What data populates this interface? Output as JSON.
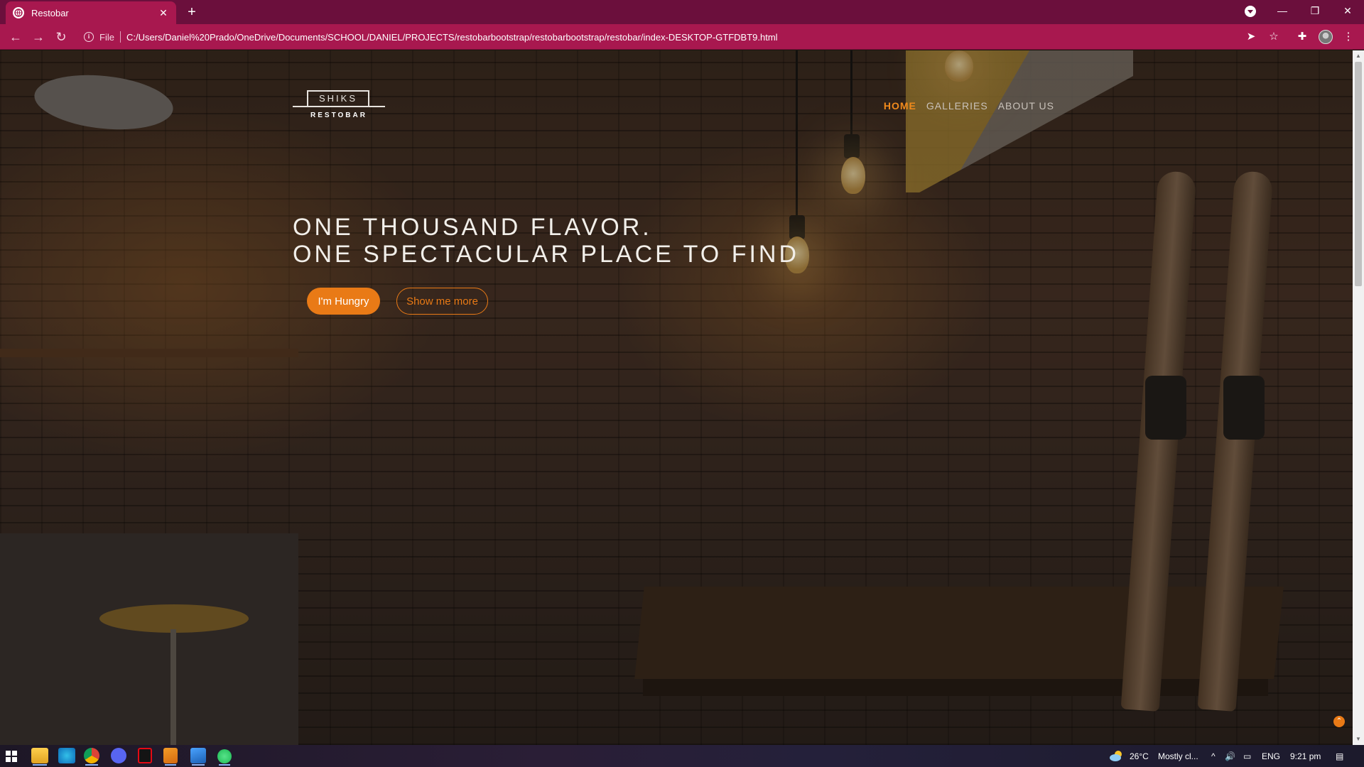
{
  "browser": {
    "tab_title": "Restobar",
    "tab_close": "✕",
    "new_tab": "+",
    "scheme_label": "File",
    "url": "C:/Users/Daniel%20Prado/OneDrive/Documents/SCHOOL/DANIEL/PROJECTS/restobarbootstrap/restobarbootstrap/restobar/index-DESKTOP-GTFDBT9.html",
    "back": "←",
    "forward": "→",
    "reload": "↻",
    "minimize": "—",
    "restore": "❐",
    "close": "✕",
    "send_icon": "➤",
    "star_icon": "☆",
    "extensions_icon": "✚",
    "menu_icon": "⋮"
  },
  "site": {
    "logo_top": "SHIKS",
    "logo_bottom": "RESTOBAR",
    "nav": [
      {
        "label": "HOME",
        "active": true
      },
      {
        "label": "GALLERIES",
        "active": false
      },
      {
        "label": "ABOUT US",
        "active": false
      }
    ],
    "hero_line1": "ONE THOUSAND FLAVOR.",
    "hero_line2": "ONE SPECTACULAR PLACE TO FIND",
    "primary_button": "I'm Hungry",
    "secondary_button": "Show me more",
    "back_to_top": "⌃",
    "accent_color": "#e97a16"
  },
  "taskbar": {
    "apps": [
      "start",
      "file-explorer",
      "edge",
      "chrome",
      "discord",
      "netflix",
      "sublime-text",
      "photos",
      "spotify"
    ],
    "weather_temp": "26°C",
    "weather_desc": "Mostly cl...",
    "language": "ENG",
    "time": "9:21 pm",
    "tray_up": "^",
    "volume_icon": "🔊",
    "network_icon": "▭",
    "notifications_icon": "▤"
  }
}
